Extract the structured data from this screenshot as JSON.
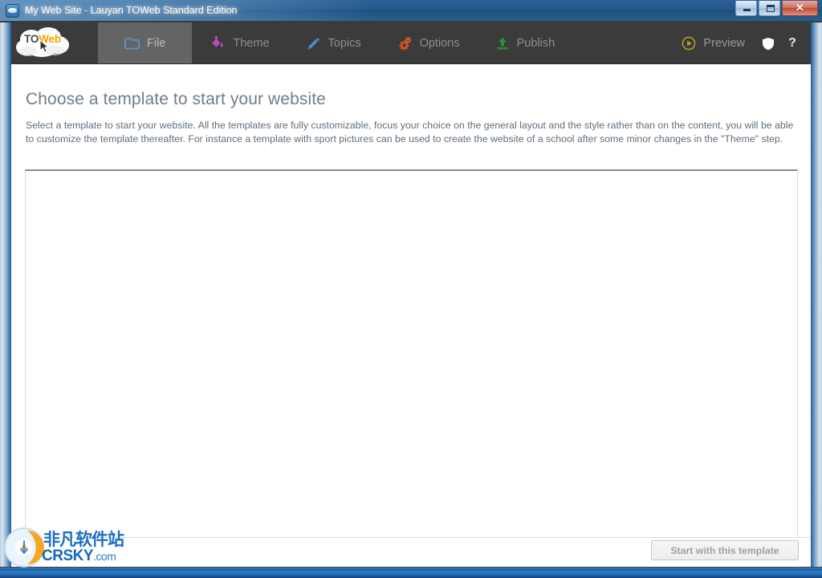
{
  "window": {
    "title": "My Web Site - Lauyan TOWeb Standard Edition",
    "app_icon": "cloud-icon",
    "controls": {
      "minimize_label": "",
      "maximize_label": "",
      "close_label": "✕"
    }
  },
  "ribbon": {
    "logo": {
      "text_dark": "TO",
      "text_accent": "Web",
      "accent_color": "#f5a300"
    },
    "tabs": [
      {
        "label": "File",
        "icon": "folder-icon",
        "icon_color": "#5b9bd5",
        "active": true
      },
      {
        "label": "Theme",
        "icon": "paint-bucket-icon",
        "icon_color": "#b34fb3",
        "active": false
      },
      {
        "label": "Topics",
        "icon": "pencil-icon",
        "icon_color": "#4a86c8",
        "active": false
      },
      {
        "label": "Options",
        "icon": "gears-icon",
        "icon_color": "#d94f1e",
        "active": false
      },
      {
        "label": "Publish",
        "icon": "upload-icon",
        "icon_color": "#2e8b3d",
        "active": false
      }
    ],
    "preview": {
      "label": "Preview",
      "icon": "play-circle-icon",
      "icon_color": "#c9a227"
    },
    "shield_icon": "shield-icon",
    "help_icon": "question-mark-icon"
  },
  "main": {
    "title": "Choose a template to start your website",
    "description": "Select a template to start your website. All the templates are fully customizable, focus your choice on the general layout and the style rather than on the content, you will be able to customize the template thereafter. For instance a template with sport pictures can be used to create the website of a school after some minor changes in the \"Theme\" step.",
    "template_gallery_empty": ""
  },
  "footer": {
    "start_button_label": "Start with this template"
  },
  "watermark": {
    "chinese": "非凡软件站",
    "site": "CRSKY",
    "tld": ".com"
  }
}
